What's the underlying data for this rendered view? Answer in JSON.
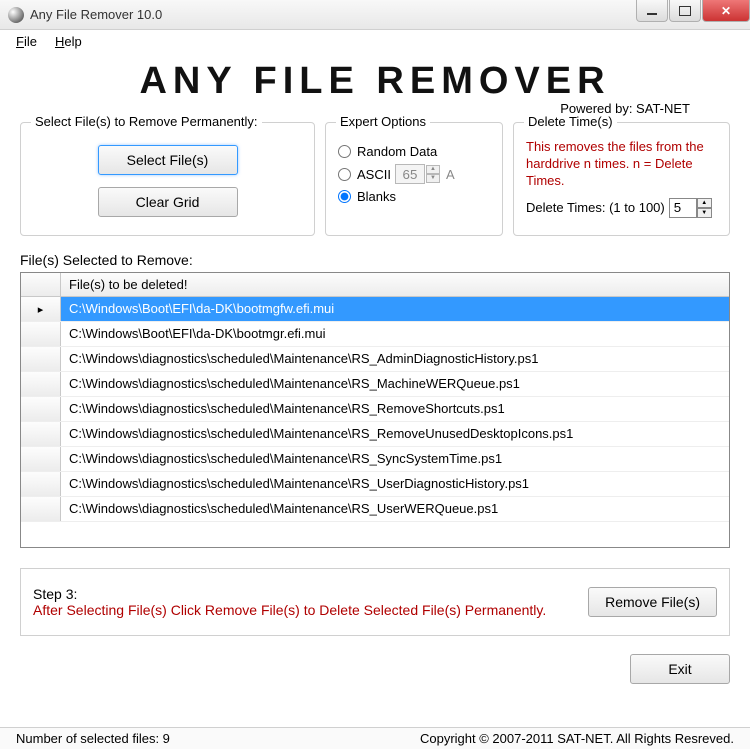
{
  "window": {
    "title": "Any File Remover 10.0"
  },
  "menubar": {
    "file": "File",
    "help": "Help"
  },
  "header": {
    "title": "ANY FILE REMOVER",
    "powered": "Powered by: SAT-NET"
  },
  "select_group": {
    "legend": "Select File(s) to Remove Permanently:",
    "select_btn": "Select File(s)",
    "clear_btn": "Clear Grid"
  },
  "expert_group": {
    "legend": "Expert Options",
    "random": "Random Data",
    "ascii": "ASCII",
    "ascii_value": "65",
    "ascii_char": "A",
    "blanks": "Blanks"
  },
  "delete_group": {
    "legend": "Delete Time(s)",
    "warn": "This removes the files from the harddrive n times. n = Delete Times.",
    "label": "Delete Times: (1 to 100)",
    "value": "5"
  },
  "files": {
    "label": "File(s) Selected to Remove:",
    "col_header": "File(s) to be deleted!",
    "rows": [
      "C:\\Windows\\Boot\\EFI\\da-DK\\bootmgfw.efi.mui",
      "C:\\Windows\\Boot\\EFI\\da-DK\\bootmgr.efi.mui",
      "C:\\Windows\\diagnostics\\scheduled\\Maintenance\\RS_AdminDiagnosticHistory.ps1",
      "C:\\Windows\\diagnostics\\scheduled\\Maintenance\\RS_MachineWERQueue.ps1",
      "C:\\Windows\\diagnostics\\scheduled\\Maintenance\\RS_RemoveShortcuts.ps1",
      "C:\\Windows\\diagnostics\\scheduled\\Maintenance\\RS_RemoveUnusedDesktopIcons.ps1",
      "C:\\Windows\\diagnostics\\scheduled\\Maintenance\\RS_SyncSystemTime.ps1",
      "C:\\Windows\\diagnostics\\scheduled\\Maintenance\\RS_UserDiagnosticHistory.ps1",
      "C:\\Windows\\diagnostics\\scheduled\\Maintenance\\RS_UserWERQueue.ps1"
    ],
    "selected_index": 0
  },
  "step3": {
    "label": "Step 3:",
    "instruction": "After Selecting File(s) Click Remove File(s) to Delete Selected File(s) Permanently.",
    "remove_btn": "Remove File(s)"
  },
  "exit_btn": "Exit",
  "status": {
    "left": "Number of selected files:  9",
    "right": "Copyright © 2007-2011 SAT-NET. All Rights Resreved."
  }
}
